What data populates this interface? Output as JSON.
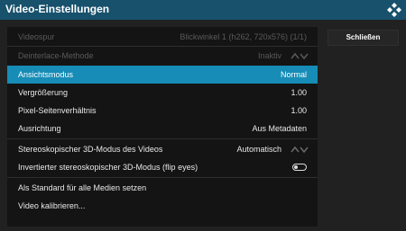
{
  "header": {
    "title": "Video-Einstellungen",
    "logo_icon": "kodi-logo-icon"
  },
  "rows": [
    {
      "label": "Videospur",
      "value": "Blickwinkel 1 (h262, 720x576) (1/1)",
      "state": "disabled"
    },
    {
      "label": "Deinterlace-Methode",
      "value": "Inaktiv",
      "state": "disabled",
      "control": "spinner"
    },
    {
      "label": "Ansichtsmodus",
      "value": "Normal",
      "state": "selected"
    },
    {
      "label": "Vergrößerung",
      "value": "1.00"
    },
    {
      "label": "Pixel-Seitenverhältnis",
      "value": "1.00"
    },
    {
      "label": "Ausrichtung",
      "value": "Aus Metadaten"
    },
    {
      "label": "Stereoskopischer 3D-Modus des Videos",
      "value": "Automatisch",
      "control": "spinner"
    },
    {
      "label": "Invertierter stereoskopischer 3D-Modus (flip eyes)",
      "control": "toggle",
      "toggle_on": false
    },
    {
      "label": "Als Standard für alle Medien setzen"
    },
    {
      "label": "Video kalibrieren..."
    }
  ],
  "side": {
    "close_label": "Schließen"
  },
  "colors": {
    "titlebar": "#17516c",
    "accent": "#168cb6",
    "panel": "#141414",
    "background": "#212121"
  }
}
